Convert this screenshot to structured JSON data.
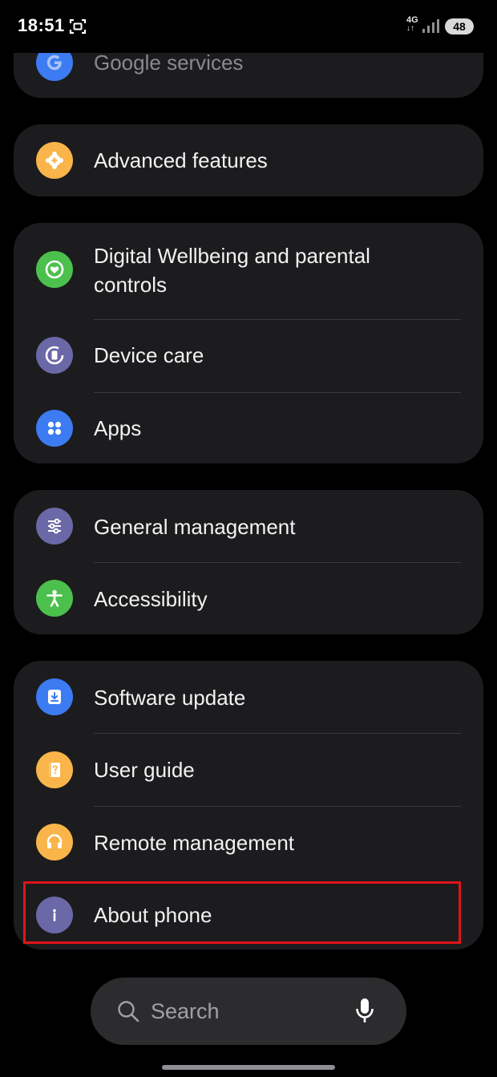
{
  "status_bar": {
    "time": "18:51",
    "network": "4G",
    "network_arrows": "↓↑",
    "battery": "48"
  },
  "menu": {
    "google_services": "Google services",
    "advanced_features": "Advanced features",
    "digital_wellbeing_line1": "Digital Wellbeing and parental",
    "digital_wellbeing_line2": "controls",
    "device_care": "Device care",
    "apps": "Apps",
    "general_management": "General management",
    "accessibility": "Accessibility",
    "software_update": "Software update",
    "user_guide": "User guide",
    "remote_management": "Remote management",
    "about_phone": "About phone"
  },
  "search": {
    "label": "Search"
  },
  "icons": {
    "google_services": "google-g-icon",
    "advanced_features": "gear-plus-icon",
    "digital_wellbeing": "heart-ring-icon",
    "device_care": "device-care-icon",
    "apps": "four-dots-icon",
    "general_management": "sliders-icon",
    "accessibility": "person-icon",
    "software_update": "download-icon",
    "user_guide": "question-book-icon",
    "remote_management": "headset-icon",
    "about_phone": "info-icon"
  },
  "colors": {
    "background": "#000000",
    "card": "#1c1c1e",
    "highlight": "#e0141b",
    "blue": "#3c7bf2",
    "orange": "#f9b54a",
    "green": "#4cc04c",
    "purple": "#6b68a8"
  }
}
